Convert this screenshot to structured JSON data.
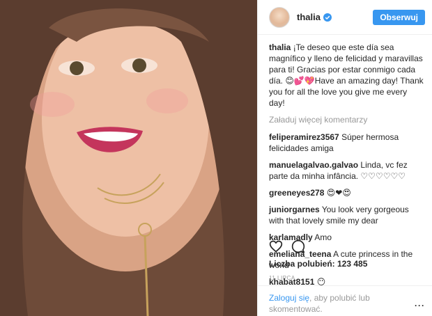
{
  "post": {
    "username": "thalia",
    "follow_label": "Obserwuj",
    "caption": "¡Te deseo que este día sea magnífico y lleno de felicidad y maravillas para ti! Gracias por estar conmigo cada día. 😊💕💖Have an amazing day! Thank you for all the love you give me every day!",
    "load_more": "Załaduj więcej komentarzy",
    "comments": [
      {
        "user": "feliperamirez3567",
        "text": "Súper hermosa felicidades amiga"
      },
      {
        "user": "manuelagalvao.galvao",
        "text": "Linda, vc fez parte da minha infância. ♡♡♡♡♡♡"
      },
      {
        "user": "greeneyes278",
        "text": "😍❤😍"
      },
      {
        "user": "juniorgarnes",
        "text": "You look very gorgeous with that lovely smile my dear"
      },
      {
        "user": "karlamadly",
        "text": "Amo"
      },
      {
        "user": "emeliana_teena",
        "text": "A cute princess in the world"
      },
      {
        "user": "khabat8151",
        "text": "😶"
      }
    ],
    "likes_text": "Liczba polubień: 123 485",
    "date": "11 LIPCA",
    "login_link": "Zaloguj się",
    "login_rest": ", aby polubić lub skomentować.",
    "more_menu": "···"
  },
  "icons": {
    "like": "heart-icon",
    "comment": "comment-icon",
    "verified": "verified-badge-icon"
  }
}
